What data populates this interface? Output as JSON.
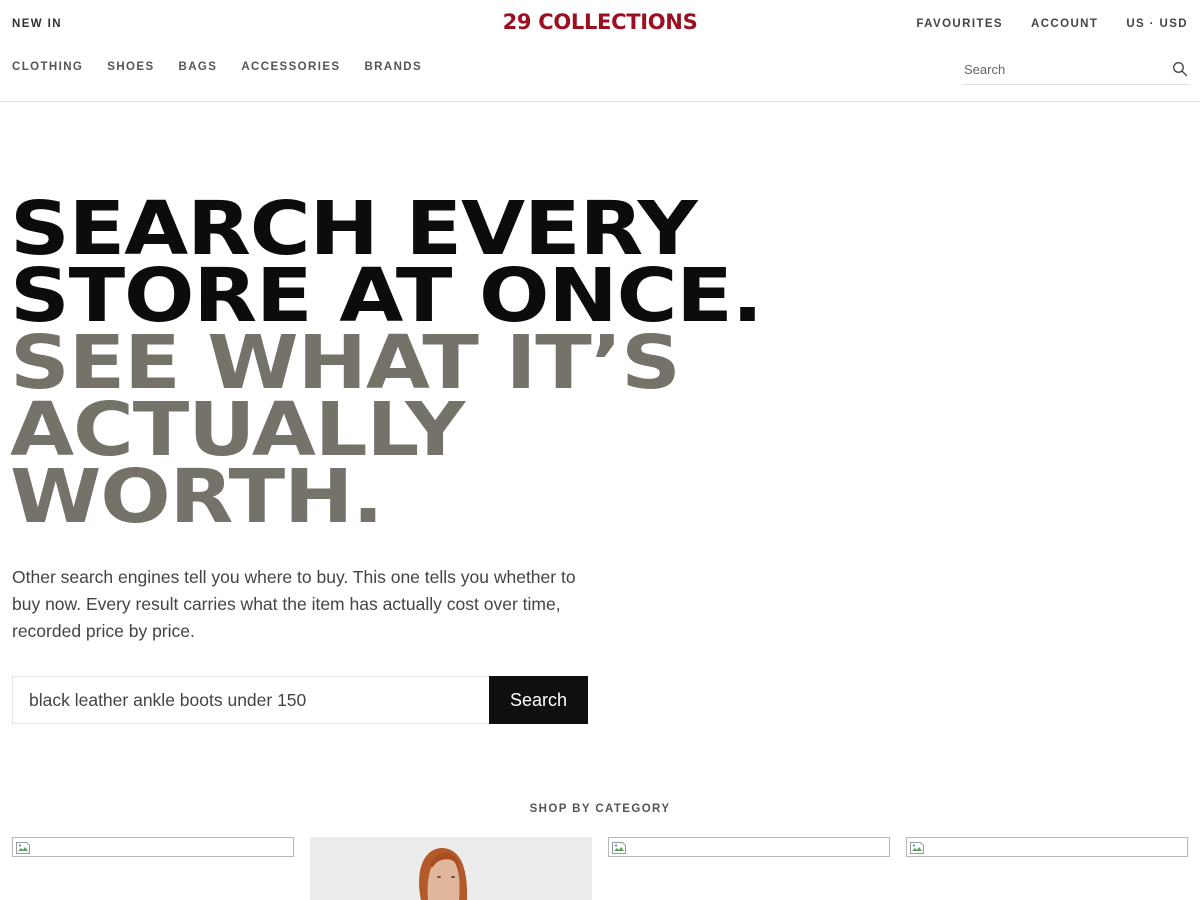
{
  "header": {
    "new_in": "NEW IN",
    "logo": "29 COLLECTIONS",
    "favourites": "FAVOURITES",
    "account": "ACCOUNT",
    "locale": "US · USD",
    "nav": [
      "CLOTHING",
      "SHOES",
      "BAGS",
      "ACCESSORIES",
      "BRANDS"
    ],
    "search_placeholder": "Search"
  },
  "hero": {
    "line1": "SEARCH EVERY",
    "line2": "STORE AT ONCE.",
    "line3": "SEE WHAT IT’S",
    "line4": "ACTUALLY",
    "line5": "WORTH.",
    "intro": "Other search engines tell you where to buy. This one tells you whether to buy now. Every result carries what the item has actually cost over time, recorded price by price.",
    "search_value": "black leather ankle boots under 150",
    "search_button": "Search"
  },
  "categories": {
    "heading": "SHOP BY CATEGORY",
    "tiles": [
      "broken-image",
      "model-photo",
      "broken-image",
      "broken-image"
    ]
  },
  "colors": {
    "logo": "#9b1020",
    "hero_dark": "#0c0c0c",
    "hero_grey": "#747269",
    "button_bg": "#0f0f0f"
  }
}
